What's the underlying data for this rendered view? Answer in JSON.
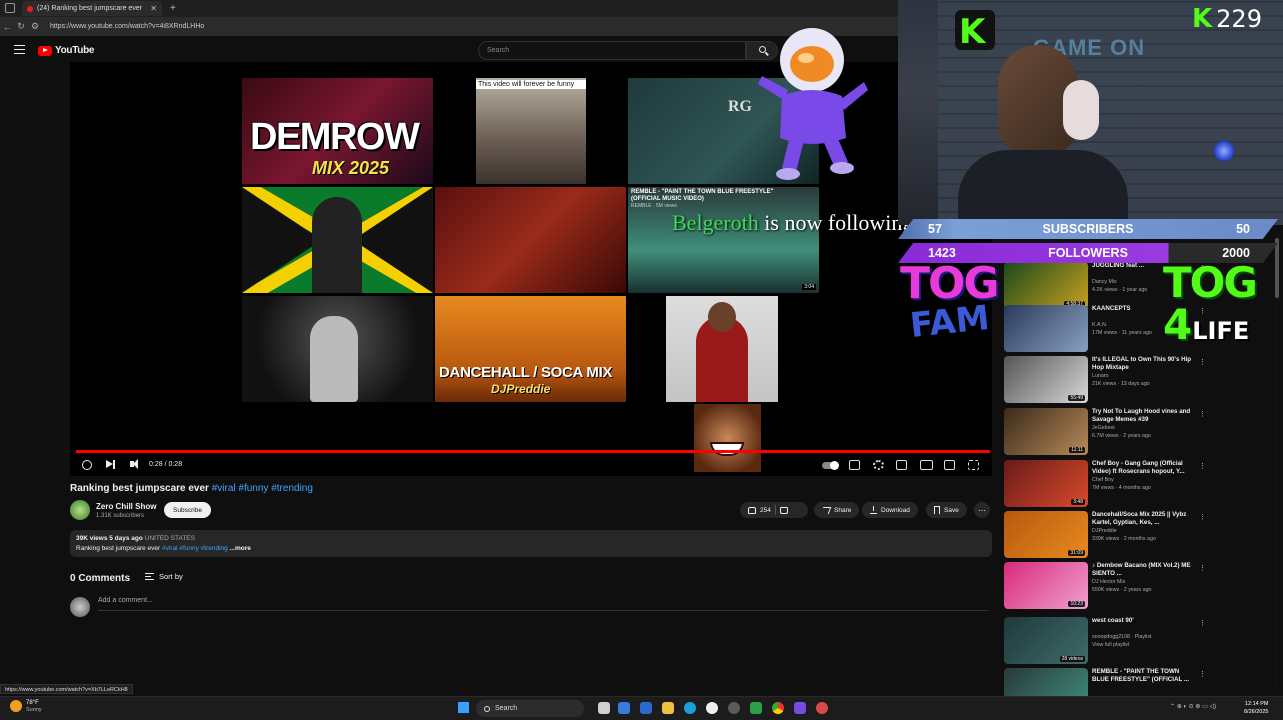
{
  "browser": {
    "tab_title": "(24) Ranking best jumpscare ever",
    "url": "https://www.youtube.com/watch?v=4i8XRndLHHo",
    "status_url": "https://www.youtube.com/watch?v=Xb7LLeRCkH8"
  },
  "youtube": {
    "logo_text": "YouTube",
    "search_placeholder": "Search"
  },
  "video": {
    "time": "0:28 / 0:28",
    "progress_fraction": 1.0,
    "follow_name": "Belgeroth",
    "follow_rest": " is now following!",
    "thumbs": {
      "demrow_big": "DEMROW",
      "demrow_mix": "MIX 2025",
      "forever_caption": "This video will forever be funny",
      "snoop_letters": "RG",
      "paint_caption": "REMBLE - \"PAINT THE TOWN BLUE FREESTYLE\" (OFFICIAL MUSIC VIDEO)",
      "paint_sub": "REMBLE · 5M views",
      "paint_dur": "3:04",
      "dancehall_title": "DANCEHALL / SOCA MIX",
      "dancehall_dj": "DJPreddie"
    }
  },
  "details": {
    "title": "Ranking best jumpscare ever",
    "title_tags": "#viral #funny #trending",
    "channel_name": "Zero Chill Show",
    "channel_subs": "1.31K subscribers",
    "subscribe_label": "Subscribe",
    "likes": "254",
    "share_label": "Share",
    "download_label": "Download",
    "save_label": "Save",
    "desc_meta": "39K views  5 days ago",
    "desc_country": "UNITED STATES",
    "desc_text": "Ranking best jumpscare ever",
    "desc_tags": "#viral #funny #trending",
    "desc_more": "...more",
    "comments_count": "0 Comments",
    "sort_label": "Sort by",
    "add_comment_placeholder": "Add a comment..."
  },
  "sidebar": {
    "items": [
      {
        "title": "JUGGLING feat ...",
        "channel": "Dancy Mix",
        "views": "4.2K views · 1 year ago",
        "duration": "4:58:37",
        "colors": [
          "#1a4a1a",
          "#c8a020"
        ]
      },
      {
        "title": "KAANCEPTS",
        "channel": "K.A.N.",
        "views": "17M views · 11 years ago",
        "duration": "",
        "colors": [
          "#2a3a5a",
          "#8aa0c0"
        ]
      },
      {
        "title": "It's ILLEGAL to Own This 90's Hip Hop Mixtape",
        "channel": "Lunaro",
        "views": "21K views · 13 days ago",
        "duration": "55:49",
        "colors": [
          "#555555",
          "#d8d8d8"
        ]
      },
      {
        "title": "Try Not To Laugh Hood vines and Savage Memes #39",
        "channel": "JeGebest",
        "views": "6.7M views · 2 years ago",
        "duration": "11:11",
        "colors": [
          "#3a2a1a",
          "#b88a5a"
        ]
      },
      {
        "title": "Chef Boy - Gang Gang (Official Video) ft Rosecrans hopout, Y...",
        "channel": "Chef Boy",
        "views": "7M views · 4 months ago",
        "duration": "3:48",
        "colors": [
          "#6a1a1a",
          "#d84a2a"
        ]
      },
      {
        "title": "Dancehall/Soca Mix 2025 || Vybz Kartel, Gyptian, Kes, ...",
        "channel": "DJPreddie",
        "views": "339K views · 2 months ago",
        "duration": "31:09",
        "colors": [
          "#b85810",
          "#e88a20"
        ]
      },
      {
        "title": "♪ Dembow Bacano (MIX Vol.2) ME SIENTO ...",
        "channel": "DJ Hector Mix",
        "views": "550K views · 2 years ago",
        "duration": "10:23",
        "colors": [
          "#d82a7a",
          "#f0a0d0"
        ]
      },
      {
        "title": "west coast 90'",
        "channel": "snoopdogg2108 · Playlist",
        "views": "View full playlist",
        "duration": "28 videos",
        "colors": [
          "#1f3a3a",
          "#3f6a6a"
        ]
      },
      {
        "title": "REMBLE - \"PAINT THE TOWN BLUE FREESTYLE\" (OFFICIAL ...",
        "channel": "",
        "views": "",
        "duration": "",
        "colors": [
          "#2a3a3a",
          "#3f8f7a"
        ]
      }
    ]
  },
  "stream": {
    "kick_count": "229",
    "gameon_text": "GAME ON",
    "subs_current": "57",
    "subs_label": "SUBSCRIBERS",
    "subs_goal": "50",
    "fol_current": "1423",
    "fol_label": "FOLLOWERS",
    "fol_goal": "2000",
    "fol_fraction": 0.7115,
    "tog_left_a": "TOG",
    "tog_left_b": "FAM",
    "tog_right_a": "TOG",
    "tog_right_b": "4",
    "tog_right_c": "LIFE"
  },
  "taskbar": {
    "temp": "78°F",
    "weather": "Sunny",
    "search_label": "Search",
    "time": "12:14 PM",
    "date": "8/26/2025"
  }
}
